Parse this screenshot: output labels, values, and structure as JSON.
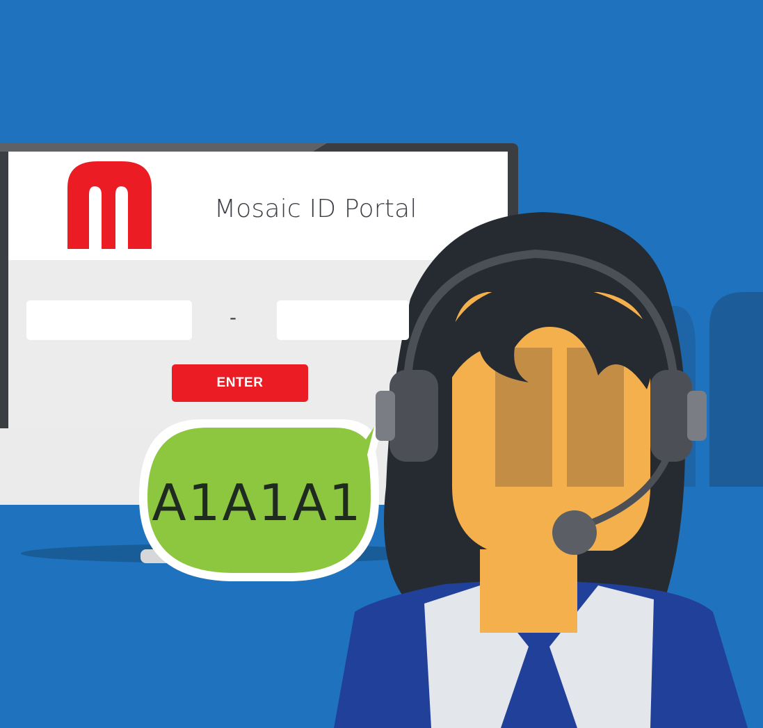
{
  "portal": {
    "title": "Mosaic ID Portal",
    "logo_icon": "mosaic-m-logo-icon",
    "id_separator": "-",
    "input_part_1": {
      "value": "",
      "placeholder": ""
    },
    "input_part_2": {
      "value": "",
      "placeholder": ""
    },
    "enter_label": "ENTER"
  },
  "speech_bubble": {
    "text": "A1A1A1"
  },
  "icons": {
    "agent": "support-agent-icon",
    "headset": "headset-icon",
    "microphone": "microphone-icon"
  },
  "colors": {
    "background_blue": "#1f72bd",
    "brand_red": "#ec1c24",
    "bubble_green": "#8dc63f",
    "skin": "#f5b04e",
    "hair": "#252b30",
    "uniform_blue": "#21409a"
  }
}
